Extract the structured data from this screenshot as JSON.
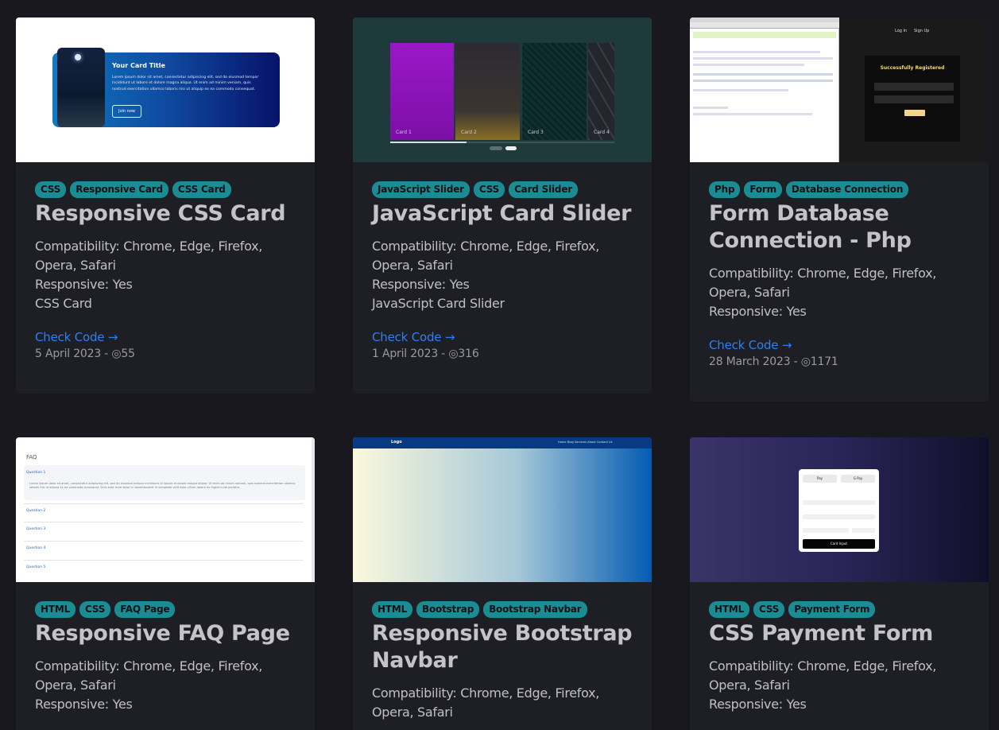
{
  "cards": [
    {
      "tags": [
        "CSS",
        "Responsive Card",
        "CSS Card"
      ],
      "title": "Responsive CSS Card",
      "compat": "Compatibility: Chrome, Edge, Firefox, Opera, Safari",
      "responsive": "Responsive: Yes",
      "extra": "CSS Card",
      "link": "Check Code →",
      "date": "5 April 2023 - ◎55",
      "thumb": {
        "card_title": "Your Card Title",
        "card_text": "Lorem ipsum dolor sit amet, consectetur adipiscing elit, sed do eiusmod tempor incididunt ut labore et dolore magna aliqua. Ut enim ad minim veniam, quis nostrud exercitation ullamco laboris nisi ut aliquip ex ea commodo consequat.",
        "button": "Join now"
      }
    },
    {
      "tags": [
        "JavaScript Slider",
        "CSS",
        "Card Slider"
      ],
      "title": "JavaScript Card Slider",
      "compat": "Compatibility: Chrome, Edge, Firefox, Opera, Safari",
      "responsive": "Responsive: Yes",
      "extra": "JavaScript Card Slider",
      "link": "Check Code →",
      "date": "1 April 2023 - ◎316",
      "thumb": {
        "labels": [
          "Card 1",
          "Card 2",
          "Card 3",
          "Card 4"
        ]
      }
    },
    {
      "tags": [
        "Php",
        "Form",
        "Database Connection"
      ],
      "title": "Form Database Connection - Php",
      "compat": "Compatibility: Chrome, Edge, Firefox, Opera, Safari",
      "responsive": "Responsive: Yes",
      "extra": "",
      "link": "Check Code →",
      "date": "28 March 2023 - ◎1171",
      "thumb": {
        "login": "Log In",
        "signup": "Sign Up",
        "registered": "Successfully Registered"
      }
    },
    {
      "tags": [
        "HTML",
        "CSS",
        "FAQ Page"
      ],
      "title": "Responsive FAQ Page",
      "compat": "Compatibility: Chrome, Edge, Firefox, Opera, Safari",
      "responsive": "Responsive: Yes",
      "extra": "",
      "link": "",
      "date": "",
      "thumb": {
        "heading": "FAQ",
        "questions": [
          "Question 1",
          "Question 2",
          "Question 3",
          "Question 4",
          "Question 5"
        ],
        "answer": "Lorem ipsum dolor sit amet, consectetur adipiscing elit, sed do eiusmod tempor incididunt ut labore et dolore magna aliqua. Ut enim ad minim veniam, quis nostrud exercitation ullamco laboris nisi ut aliquip ex ea commodo consequat. Duis aute irure dolor in reprehenderit in voluptate velit esse cillum dolore eu fugiat nulla pariatur."
      }
    },
    {
      "tags": [
        "HTML",
        "Bootstrap",
        "Bootstrap Navbar"
      ],
      "title": "Responsive Bootstrap Navbar",
      "compat": "Compatibility: Chrome, Edge, Firefox, Opera, Safari",
      "responsive": "",
      "extra": "",
      "link": "",
      "date": "",
      "thumb": {
        "logo": "Logo",
        "links": "Home   Blog   Services   About   Contact Us"
      }
    },
    {
      "tags": [
        "HTML",
        "CSS",
        "Payment Form"
      ],
      "title": "CSS Payment Form",
      "compat": "Compatibility: Chrome, Edge, Firefox, Opera, Safari",
      "responsive": "Responsive: Yes",
      "extra": "",
      "link": "",
      "date": "",
      "thumb": {
        "apple_pay": " Pay",
        "google_pay": "G Pay",
        "pay_button": "Card Input"
      }
    }
  ]
}
